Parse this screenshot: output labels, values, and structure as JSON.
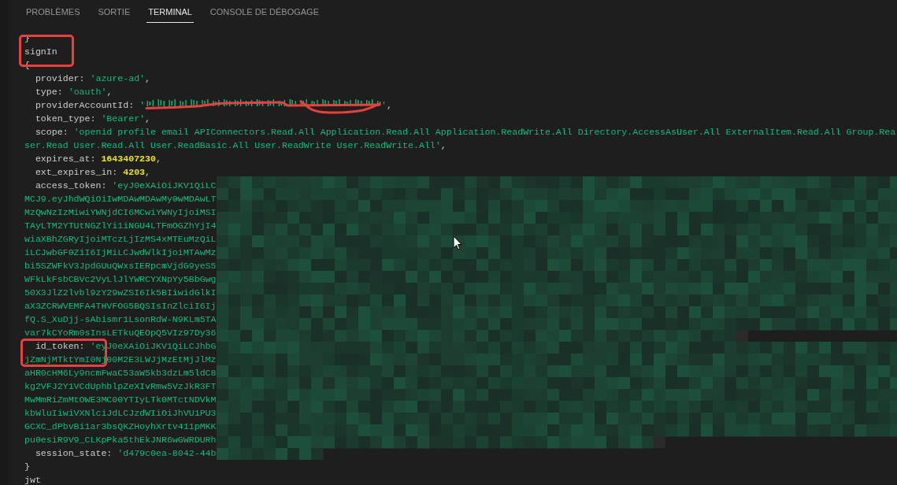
{
  "panel_tabs": [
    {
      "label": "PROBLÈMES",
      "selected": false
    },
    {
      "label": "SORTIE",
      "selected": false
    },
    {
      "label": "TERMINAL",
      "selected": true
    },
    {
      "label": "CONSOLE DE DÉBOGAGE",
      "selected": false
    }
  ],
  "terminal": {
    "lines": [
      {
        "segments": [
          {
            "kind": "plain",
            "text": "}"
          }
        ]
      },
      {
        "segments": [
          {
            "kind": "plain",
            "text": "signIn"
          }
        ]
      },
      {
        "segments": [
          {
            "kind": "plain",
            "text": "{"
          }
        ]
      },
      {
        "segments": [
          {
            "kind": "plain",
            "text": "  provider: "
          },
          {
            "kind": "string",
            "text": "'azure-ad'"
          },
          {
            "kind": "plain",
            "text": ","
          }
        ]
      },
      {
        "segments": [
          {
            "kind": "plain",
            "text": "  type: "
          },
          {
            "kind": "string",
            "text": "'oauth'"
          },
          {
            "kind": "plain",
            "text": ","
          }
        ]
      },
      {
        "segments": [
          {
            "kind": "plain",
            "text": "  providerAccountId: "
          },
          {
            "kind": "string",
            "text": "'"
          },
          {
            "kind": "scribbled"
          },
          {
            "kind": "string",
            "text": "'"
          },
          {
            "kind": "plain",
            "text": ","
          }
        ]
      },
      {
        "segments": [
          {
            "kind": "plain",
            "text": "  token_type: "
          },
          {
            "kind": "string",
            "text": "'Bearer'"
          },
          {
            "kind": "plain",
            "text": ","
          }
        ]
      },
      {
        "segments": [
          {
            "kind": "plain",
            "text": "  scope: "
          },
          {
            "kind": "string",
            "text": "'openid profile email APIConnectors.Read.All Application.Read.All Application.ReadWrite.All Directory.AccessAsUser.All ExternalItem.Read.All Group.Rea"
          }
        ]
      },
      {
        "segments": [
          {
            "kind": "string",
            "text": "ser.Read User.Read.All User.ReadBasic.All User.ReadWrite User.ReadWrite.All'"
          },
          {
            "kind": "plain",
            "text": ","
          }
        ]
      },
      {
        "segments": [
          {
            "kind": "plain",
            "text": "  expires_at: "
          },
          {
            "kind": "number",
            "text": "1643407230"
          },
          {
            "kind": "plain",
            "text": ","
          }
        ]
      },
      {
        "segments": [
          {
            "kind": "plain",
            "text": "  ext_expires_in: "
          },
          {
            "kind": "number",
            "text": "4203"
          },
          {
            "kind": "plain",
            "text": ","
          }
        ]
      },
      {
        "segments": [
          {
            "kind": "plain",
            "text": "  access_token: "
          },
          {
            "kind": "string",
            "text": "'eyJ0eXAiOiJKV1QiLC"
          }
        ]
      },
      {
        "segments": [
          {
            "kind": "string",
            "text": "MCJ9.eyJhdWQiOiIwMDAwMDAwMy0wMDAwLT"
          }
        ]
      },
      {
        "segments": [
          {
            "kind": "string",
            "text": "MzQwNzIzMiwiYWNjdCI6MCwiYWNyIjoiMSI"
          }
        ]
      },
      {
        "segments": [
          {
            "kind": "string",
            "text": "TAyLTM2YTUtNGZlYi1iNGU4LTFmOGZhYjI4"
          }
        ]
      },
      {
        "segments": [
          {
            "kind": "string",
            "text": "wiaXBhZGRyIjoiMTczLjIzMS4xMTEuMzQiL"
          }
        ]
      },
      {
        "segments": [
          {
            "kind": "string",
            "text": "iLCJwbGF0ZiI6IjMiLCJwdWlkIjoiMTAwMz"
          }
        ]
      },
      {
        "segments": [
          {
            "kind": "string",
            "text": "bi5SZWFkV3JpdGUuQWxsIERpcmVjdG9yeS5"
          }
        ]
      },
      {
        "segments": [
          {
            "kind": "string",
            "text": "WFkLkFsbCBVc2VyLlJlYWRCYXNpYy5BbGwg"
          }
        ]
      },
      {
        "segments": [
          {
            "kind": "string",
            "text": "50X3JlZ2lvbl9zY29wZSI6Ik5BIiwidGlkI"
          }
        ]
      },
      {
        "segments": [
          {
            "kind": "string",
            "text": "aX3ZCRWVEMFA4THVFOG5BQSIsInZlciI6Ij"
          }
        ]
      },
      {
        "segments": [
          {
            "kind": "string",
            "text": "fQ.S_XuDjj-sAbismr1LsonRdW-N9KLm5TA"
          }
        ]
      },
      {
        "segments": [
          {
            "kind": "string",
            "text": "var7kCYoRm0sInsLETkuQEOpQ5VIz97Dy36"
          }
        ]
      },
      {
        "segments": [
          {
            "kind": "plain",
            "text": "  id_token: "
          },
          {
            "kind": "string",
            "text": "'eyJ0eXAiOiJKV1QiLCJhbG"
          }
        ]
      },
      {
        "segments": [
          {
            "kind": "string",
            "text": "jZmNjMTktYmI0Nj00M2E3LWJjMzEtMjJlMz"
          }
        ]
      },
      {
        "segments": [
          {
            "kind": "string",
            "text": "aHR0cHM6Ly9ncmFwaC53aW5kb3dzLm5ldC8"
          }
        ]
      },
      {
        "segments": [
          {
            "kind": "string",
            "text": "kg2VFJ2Y1VCdUphblpZeXIvRmw5VzJkR3FT"
          }
        ]
      },
      {
        "segments": [
          {
            "kind": "string",
            "text": "MwMmRiZmMtOWE3MC00YTIyLTk0MTctNDVkM"
          }
        ]
      },
      {
        "segments": [
          {
            "kind": "string",
            "text": "kbWluIiwiVXNlciJdLCJzdWIiOiJhVU1PU3"
          }
        ]
      },
      {
        "segments": [
          {
            "kind": "string",
            "text": "GCXC_dPbvBi1ar3bsQKZHoyhXrtv411pMKK"
          }
        ]
      },
      {
        "segments": [
          {
            "kind": "string",
            "text": "pu0esiR9V9_CLKpPka5thEkJNR6wGWRDURh"
          }
        ]
      },
      {
        "segments": [
          {
            "kind": "plain",
            "text": "  session_state: "
          },
          {
            "kind": "string",
            "text": "'d479c0ea-8042-44b"
          }
        ]
      },
      {
        "segments": [
          {
            "kind": "plain",
            "text": "}"
          }
        ]
      },
      {
        "segments": [
          {
            "kind": "plain",
            "text": "jwt"
          }
        ]
      }
    ]
  }
}
